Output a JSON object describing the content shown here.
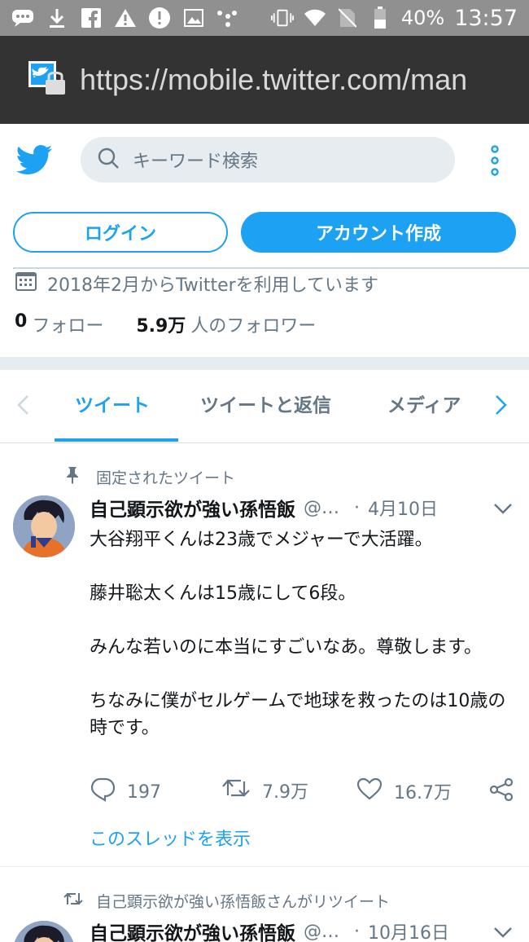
{
  "status_bar": {
    "battery": "40%",
    "time": "13:57"
  },
  "browser": {
    "url": "https://mobile.twitter.com/man"
  },
  "header": {
    "search_placeholder": "キーワード検索"
  },
  "auth": {
    "login_label": "ログイン",
    "signup_label": "アカウント作成"
  },
  "profile": {
    "joined": "2018年2月からTwitterを利用しています",
    "following_count": "0",
    "following_label": "フォロー",
    "followers_count": "5.9万",
    "followers_label": "人のフォロワー"
  },
  "tabs": [
    {
      "label": "ツイート",
      "active": true
    },
    {
      "label": "ツイートと返信",
      "active": false
    },
    {
      "label": "メディア",
      "active": false
    }
  ],
  "pinned_tweet": {
    "pinned_label": "固定されたツイート",
    "name": "自己顕示欲が強い孫悟飯",
    "handle": "@…",
    "dot": "·",
    "date": "4月10日",
    "paragraphs": [
      "大谷翔平くんは23歳でメジャーで大活躍。",
      "藤井聡太くんは15歳にして6段。",
      "みんな若いのに本当にすごいなあ。尊敬します。",
      "ちなみに僕がセルゲームで地球を救ったのは10歳の時です。"
    ],
    "replies": "197",
    "retweets": "7.9万",
    "likes": "16.7万",
    "thread_link": "このスレッドを表示"
  },
  "second_tweet": {
    "retweet_label": "自己顕示欲が強い孫悟飯さんがリツイート",
    "name": "自己顕示欲が強い孫悟飯",
    "handle": "@…",
    "dot": "·",
    "date": "10月16日"
  },
  "colors": {
    "brand": "#1da1f2",
    "muted": "#657786",
    "status_bar": "#909090",
    "url_bar": "#333333"
  }
}
